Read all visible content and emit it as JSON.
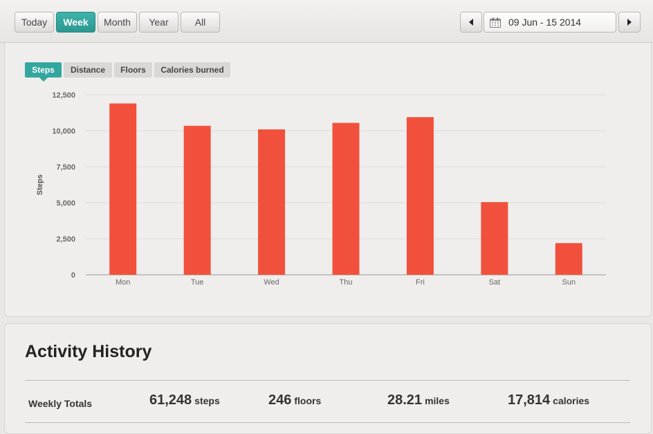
{
  "toolbar": {
    "ranges": [
      {
        "label": "Today",
        "active": false
      },
      {
        "label": "Week",
        "active": true
      },
      {
        "label": "Month",
        "active": false
      },
      {
        "label": "Year",
        "active": false
      },
      {
        "label": "All",
        "active": false
      }
    ],
    "date_range": "09 Jun - 15 2014",
    "icons": {
      "prev": "caret-left-icon",
      "next": "caret-right-icon",
      "calendar": "calendar-icon"
    }
  },
  "metric_tabs": [
    {
      "label": "Steps",
      "active": true
    },
    {
      "label": "Distance",
      "active": false
    },
    {
      "label": "Floors",
      "active": false
    },
    {
      "label": "Calories burned",
      "active": false
    }
  ],
  "chart_data": {
    "type": "bar",
    "categories": [
      "Mon",
      "Tue",
      "Wed",
      "Thu",
      "Fri",
      "Sat",
      "Sun"
    ],
    "values": [
      11900,
      10350,
      10100,
      10550,
      10950,
      5050,
      2200
    ],
    "title": "",
    "xlabel": "",
    "ylabel": "Steps",
    "ylim": [
      0,
      12500
    ],
    "yticks": [
      0,
      2500,
      5000,
      7500,
      10000,
      12500
    ],
    "ytick_labels": [
      "0",
      "2,500",
      "5,000",
      "7,500",
      "10,000",
      "12,500"
    ],
    "grid": true,
    "bar_color": "#f1513c"
  },
  "history": {
    "title": "Activity History",
    "totals_label": "Weekly Totals",
    "totals": [
      {
        "value": "61,248",
        "unit": "steps"
      },
      {
        "value": "246",
        "unit": "floors"
      },
      {
        "value": "28.21",
        "unit": "miles"
      },
      {
        "value": "17,814",
        "unit": "calories"
      }
    ]
  },
  "colors": {
    "accent": "#33a79f",
    "bar": "#f1513c"
  }
}
